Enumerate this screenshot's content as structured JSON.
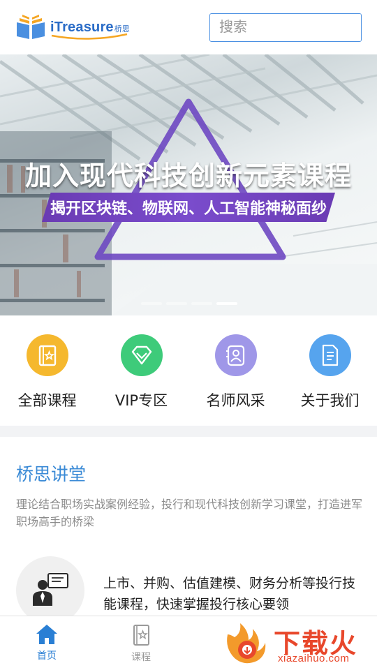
{
  "header": {
    "logo_word": "iTreasure",
    "logo_cn": "桥思",
    "search_placeholder": "搜索"
  },
  "banner": {
    "title": "加入现代科技创新元素课程",
    "subtitle": "揭开区块链、物联网、人工智能神秘面纱",
    "slide_count": 4,
    "active_slide": 4
  },
  "quicknav": [
    {
      "label": "全部课程",
      "icon": "book-star-icon",
      "color": "#f5b82e"
    },
    {
      "label": "VIP专区",
      "icon": "diamond-icon",
      "color": "#3ecb7a"
    },
    {
      "label": "名师风采",
      "icon": "teacher-card-icon",
      "color": "#9f97e8"
    },
    {
      "label": "关于我们",
      "icon": "document-icon",
      "color": "#56a4ee"
    }
  ],
  "lecture": {
    "title": "桥思讲堂",
    "description": "理论结合职场实战案例经验，投行和现代科技创新学习课堂，打造进军职场高手的桥梁",
    "feature_text": "上市、并购、估值建模、财务分析等投行技能课程，快速掌握投行核心要领",
    "feature_icon": "presenter-icon"
  },
  "tabbar": {
    "tabs": [
      {
        "label": "首页",
        "icon": "home-icon",
        "active": true
      },
      {
        "label": "课程",
        "icon": "course-book-icon",
        "active": false
      }
    ]
  },
  "watermark": {
    "text": "下载火",
    "url": "xiazaihuo.com"
  },
  "colors": {
    "primary": "#4a90e2",
    "accent_title": "#3a8ad6",
    "ribbon": "#7a4ccc"
  }
}
